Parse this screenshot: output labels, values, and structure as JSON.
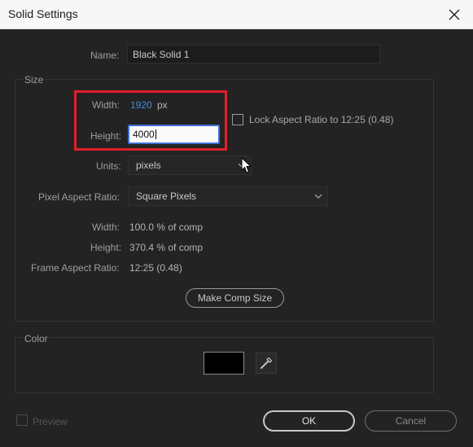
{
  "window": {
    "title": "Solid Settings"
  },
  "name": {
    "label": "Name:",
    "value": "Black Solid 1"
  },
  "size": {
    "group_title": "Size",
    "width_label": "Width:",
    "width_value": "1920",
    "width_unit": "px",
    "height_label": "Height:",
    "height_value": "4000",
    "lock_label": "Lock Aspect Ratio to 12:25 (0.48)",
    "lock_checked": false,
    "units_label": "Units:",
    "units_value": "pixels",
    "par_label": "Pixel Aspect Ratio:",
    "par_value": "Square Pixels",
    "info_width_label": "Width:",
    "info_width_value": "100.0 % of comp",
    "info_height_label": "Height:",
    "info_height_value": "370.4 % of comp",
    "info_far_label": "Frame Aspect Ratio:",
    "info_far_value": "12:25 (0.48)",
    "make_comp_size_label": "Make Comp Size"
  },
  "color": {
    "group_title": "Color",
    "swatch_color": "#000000"
  },
  "footer": {
    "preview_label": "Preview",
    "ok_label": "OK",
    "cancel_label": "Cancel"
  },
  "colors": {
    "highlight": "#e0202a",
    "accent_link": "#3d8ee0",
    "focus_border": "#3f6fd8"
  },
  "icons": {
    "close": "close-icon",
    "eyedropper": "eyedropper-icon",
    "chevron": "chevron-down-icon",
    "cursor": "mouse-pointer-icon"
  }
}
